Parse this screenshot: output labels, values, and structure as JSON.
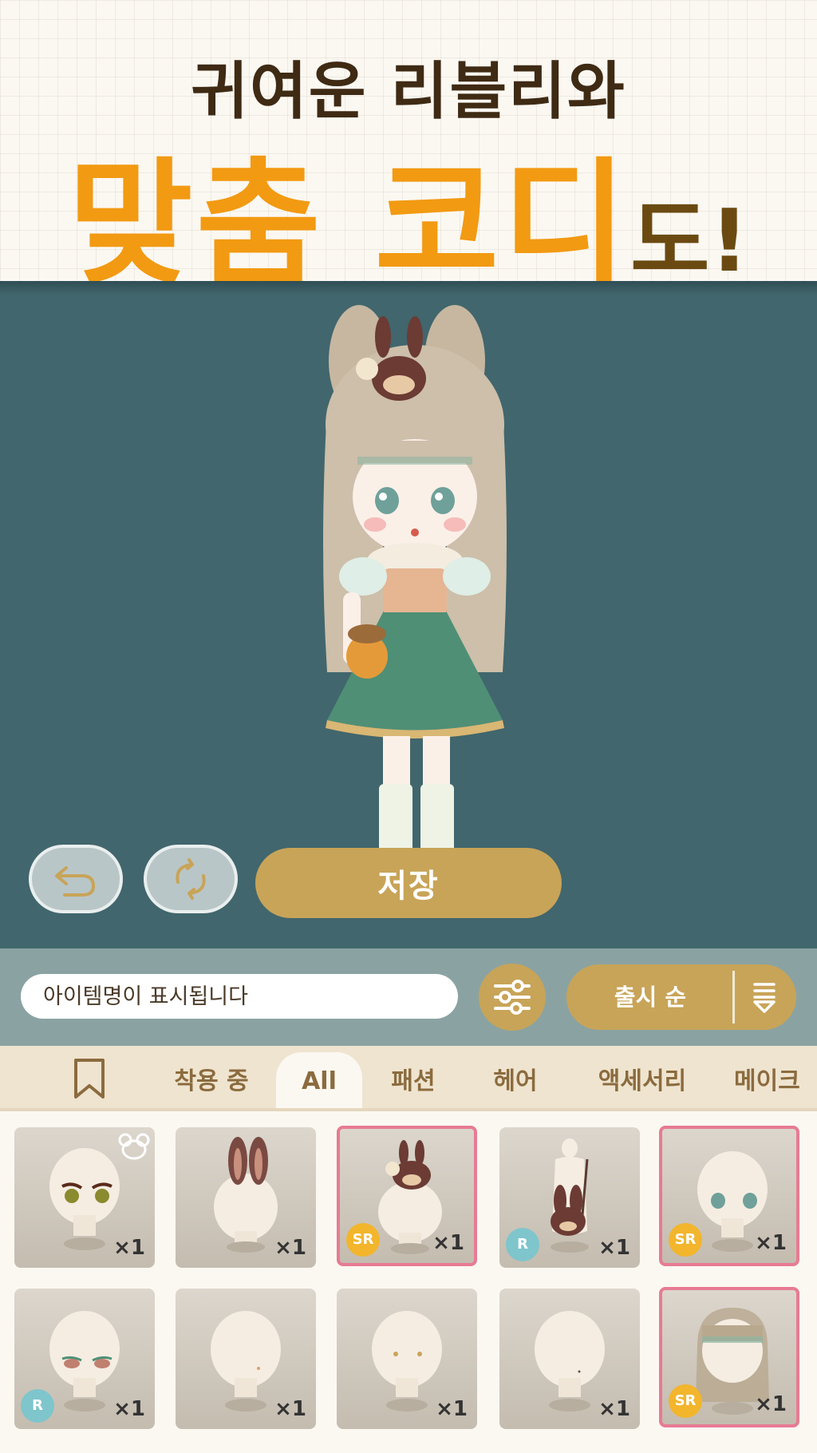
{
  "promo": {
    "line1": "귀여운 리블리와",
    "line2_big": "맞춤 코디",
    "line2_small": "도!"
  },
  "colors": {
    "accent": "#c8a458",
    "stage_bg": "#41666d",
    "promo_orange": "#f29a12",
    "selected_border": "#e77b93",
    "sr_badge": "#f2b52c",
    "r_badge": "#7fc5cc"
  },
  "stage": {
    "undo_icon": "undo-icon",
    "refresh_icon": "refresh-icon",
    "save_label": "저장"
  },
  "search": {
    "placeholder": "아이템명이 표시됩니다",
    "filter_icon": "sliders-icon",
    "sort_label": "출시 순",
    "sort_icon": "sort-descending-icon"
  },
  "tabs": [
    {
      "label": "착용 중"
    },
    {
      "label": "All",
      "active": true
    },
    {
      "label": "패션"
    },
    {
      "label": "헤어"
    },
    {
      "label": "액세서리"
    },
    {
      "label": "메이크"
    }
  ],
  "items": [
    {
      "quantity": "×1",
      "rarity": "",
      "selected": false
    },
    {
      "quantity": "×1",
      "rarity": "",
      "selected": false
    },
    {
      "quantity": "×1",
      "rarity": "SR",
      "selected": true
    },
    {
      "quantity": "×1",
      "rarity": "R",
      "selected": false
    },
    {
      "quantity": "×1",
      "rarity": "SR",
      "selected": true
    },
    {
      "quantity": "×1",
      "rarity": "R",
      "selected": false
    },
    {
      "quantity": "×1",
      "rarity": "",
      "selected": false
    },
    {
      "quantity": "×1",
      "rarity": "",
      "selected": false
    },
    {
      "quantity": "×1",
      "rarity": "",
      "selected": false
    },
    {
      "quantity": "×1",
      "rarity": "SR",
      "selected": true
    }
  ]
}
